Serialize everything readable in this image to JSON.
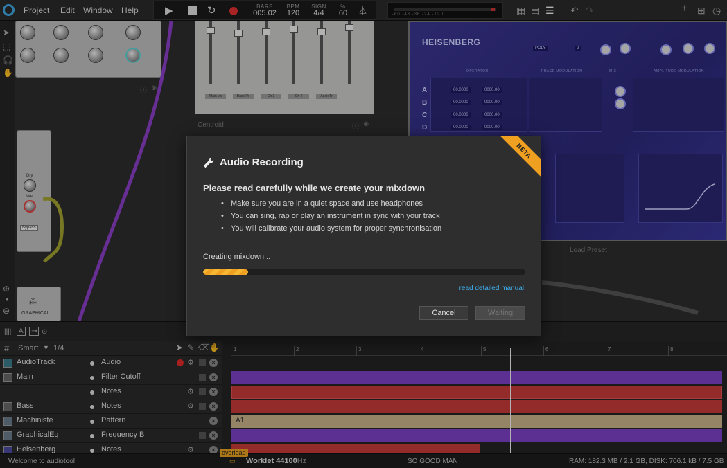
{
  "menu": {
    "items": [
      "Project",
      "Edit",
      "Window",
      "Help"
    ]
  },
  "transport": {
    "bars_label": "BARS",
    "bars_value": "005.02",
    "bpm_label": "BPM",
    "bpm_value": "120",
    "sign_label": "SIGN",
    "sign_value": "4/4",
    "swing_label": "%",
    "swing_value": "60",
    "meter_scale": "-60 -48 -36 -24 -12 0",
    "meter_level": 0.9
  },
  "devices": {
    "mixer_name": "Centroid",
    "mixer_channels": [
      "Main Vo",
      "Bass Vo",
      "Ch 3",
      "Ch 4",
      "AudioTr"
    ],
    "heisenberg_title": "HEISENBERG",
    "heisenberg_voices": "POLY",
    "heisenberg_unison": "2",
    "heisenberg_rows": [
      "A",
      "B",
      "C",
      "D"
    ],
    "heisenberg_values": [
      "00.0000",
      "0000.00"
    ],
    "heisenberg_section_labels": [
      "OPERATOR",
      "PHASE MODULATION",
      "MIX",
      "AMPLITUDE MODULATION"
    ],
    "load_preset": "Load Preset",
    "graphical_label": "GRAPHICAL",
    "bypass_label": "Bypass",
    "dry_label": "Dry",
    "wet_label": "Wet"
  },
  "dialog": {
    "title": "Audio Recording",
    "badge": "BETA",
    "heading": "Please read carefully while we create your mixdown",
    "bullets": [
      "Make sure you are in a quiet space and use headphones",
      "You can sing, rap or play an instrument in sync with your track",
      "You will calibrate your audio system for proper synchronisation"
    ],
    "status": "Creating mixdown...",
    "progress": 0.14,
    "link": "read detailed manual",
    "cancel_label": "Cancel",
    "waiting_label": "Waiting",
    "accent": "#f0a020"
  },
  "tracks": {
    "snap_label": "Smart",
    "grid_value": "1/4",
    "rows": [
      {
        "name": "AudioTrack",
        "param": "Audio",
        "color": "#5aa"
      },
      {
        "name": "Main",
        "param": "Filter Cutoff",
        "color": "#777"
      },
      {
        "name": "",
        "param": "Notes",
        "color": ""
      },
      {
        "name": "Bass",
        "param": "Notes",
        "color": "#777"
      },
      {
        "name": "Machiniste",
        "param": "Pattern",
        "color": "#889"
      },
      {
        "name": "GraphicalEq",
        "param": "Frequency B",
        "color": "#889"
      },
      {
        "name": "Heisenberg",
        "param": "Notes",
        "color": "#55a"
      }
    ]
  },
  "timeline": {
    "ruler": [
      "1",
      "2",
      "3",
      "4",
      "5",
      "6",
      "7",
      "8"
    ],
    "clip_label": "A1",
    "clip_colors": [
      "#7b3fc4",
      "#c43a3a",
      "#c43a3a",
      "#c8b088",
      "#7b3fc4",
      "#c43a3a"
    ]
  },
  "status": {
    "welcome": "Welcome to audiotool",
    "overload": "overload",
    "worklet": "Worklet 44100",
    "worklet_unit": "Hz",
    "song": "SO GOOD MAN",
    "resources": "RAM: 182.3 MB / 2.1 GB, DISK: 706.1 kB / 7.5 GB"
  }
}
